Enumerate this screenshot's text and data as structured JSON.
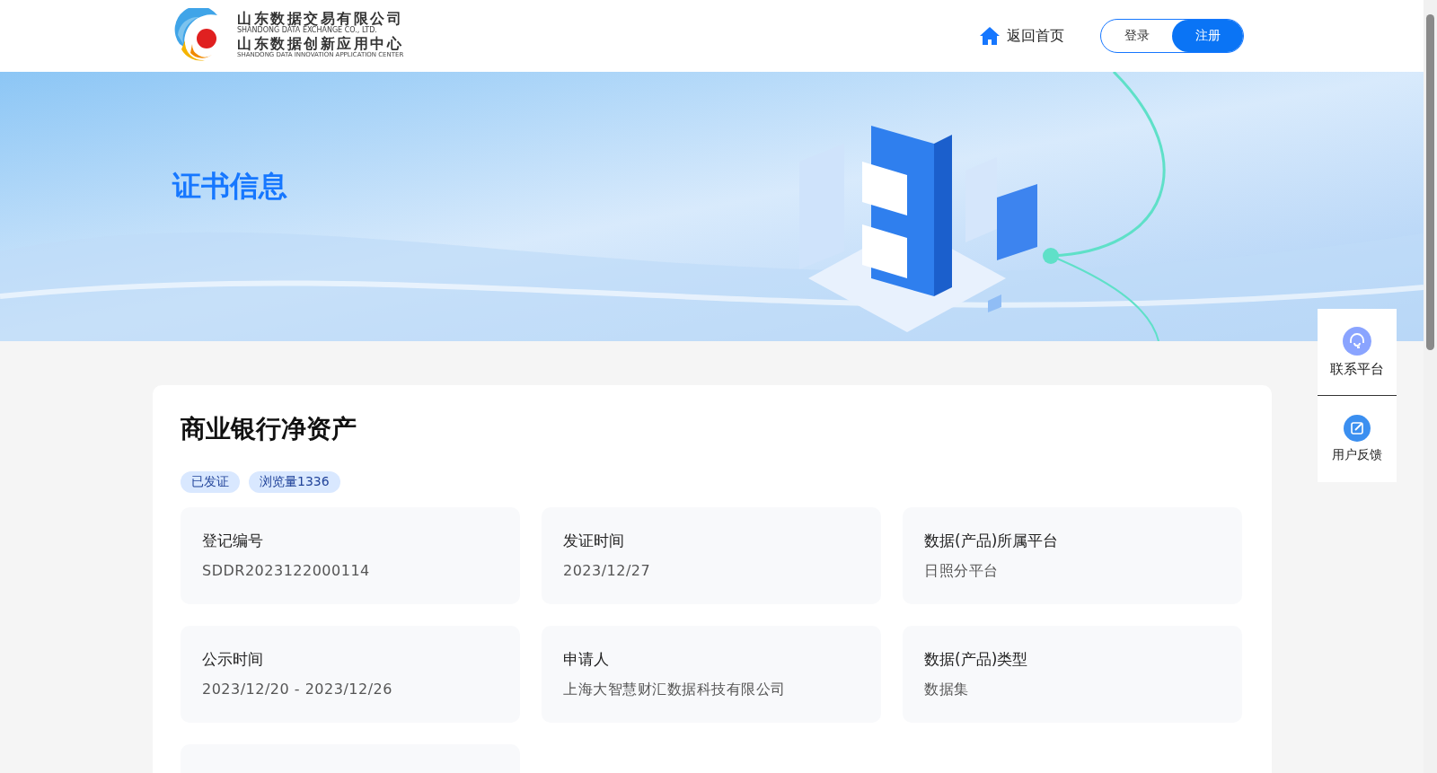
{
  "header": {
    "logo_lines": [
      "山东数据交易有限公司",
      "SHANDONG DATA EXCHANGE CO., LTD.",
      "山东数据创新应用中心",
      "SHANDONG DATA INNOVATION APPLICATION CENTER"
    ],
    "home_link": "返回首页",
    "auth": [
      {
        "label": "登录",
        "selected": false
      },
      {
        "label": "注册",
        "selected": true
      }
    ]
  },
  "banner": {
    "title": "证书信息"
  },
  "detail": {
    "title": "商业银行净资产",
    "tags": [
      "已发证",
      "浏览量1336"
    ],
    "fields": [
      {
        "kind": "info",
        "label": "登记编号",
        "value": "SDDR2023122000114"
      },
      {
        "kind": "info",
        "label": "发证时间",
        "value": "2023/12/27"
      },
      {
        "kind": "info",
        "label": "数据(产品)所属平台",
        "value": "日照分平台"
      },
      {
        "kind": "info",
        "label": "公示时间",
        "value": "2023/12/20 - 2023/12/26"
      },
      {
        "kind": "info",
        "label": "申请人",
        "value": "上海大智慧财汇数据科技有限公司"
      },
      {
        "kind": "info",
        "label": "数据(产品)类型",
        "value": "数据集"
      },
      {
        "kind": "blank"
      }
    ]
  },
  "side_panel": [
    {
      "kind": "contact",
      "label": "联系平台"
    },
    {
      "kind": "feedback",
      "label": "用户反馈"
    }
  ]
}
